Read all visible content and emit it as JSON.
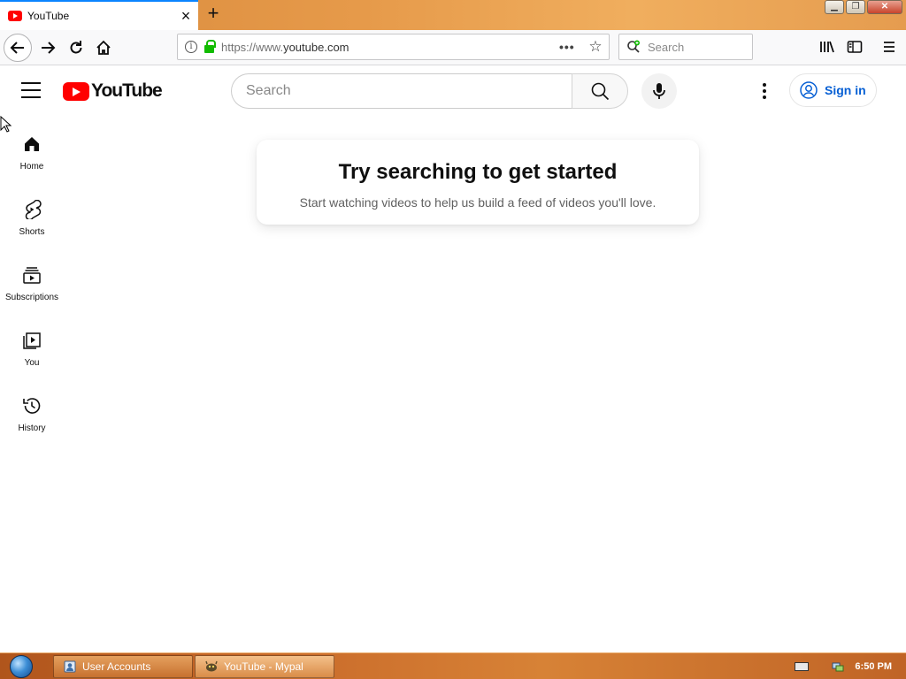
{
  "browser": {
    "tab_title": "YouTube",
    "tab_close": "×",
    "new_tab": "+",
    "url_prefix": "https://www.",
    "url_domain": "youtube.com",
    "page_actions": "•••",
    "bookmark_star": "☆",
    "search_placeholder": "Search",
    "window_buttons": {
      "minimize": "▁",
      "restore": "❐",
      "close": "✕"
    }
  },
  "youtube": {
    "logo_text": "YouTube",
    "search_placeholder": "Search",
    "signin_label": "Sign in",
    "guide": [
      {
        "label": "Home",
        "icon": "home-icon"
      },
      {
        "label": "Shorts",
        "icon": "shorts-icon"
      },
      {
        "label": "Subscriptions",
        "icon": "subscriptions-icon"
      },
      {
        "label": "You",
        "icon": "you-icon"
      },
      {
        "label": "History",
        "icon": "history-icon"
      }
    ],
    "empty_title": "Try searching to get started",
    "empty_subtitle": "Start watching videos to help us build a feed of videos you'll love."
  },
  "taskbar": {
    "tasks": [
      {
        "label": "User Accounts",
        "icon": "user-accounts-icon"
      },
      {
        "label": "YouTube - Mypal",
        "icon": "mypal-icon"
      }
    ],
    "clock": "6:50 PM"
  },
  "colors": {
    "brand_red": "#ff0000",
    "link_blue": "#065fd4",
    "tab_accent": "#0a84ff",
    "lock_green": "#12bc00"
  }
}
